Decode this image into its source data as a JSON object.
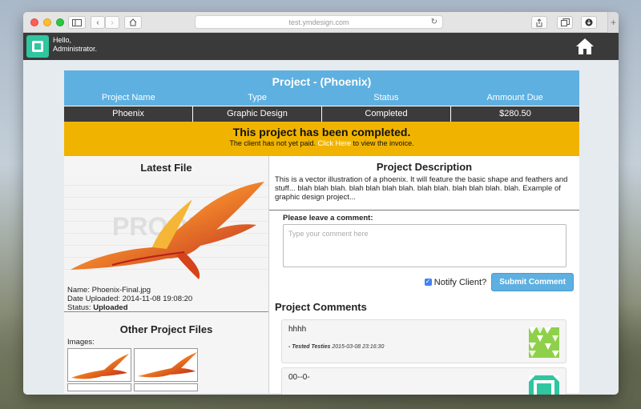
{
  "browser": {
    "address": "test.ymdesign.com"
  },
  "app": {
    "greeting_line1": "Hello,",
    "greeting_line2": "Administrator."
  },
  "project": {
    "title": "Project - (Phoenix)",
    "columns": [
      "Project Name",
      "Type",
      "Status",
      "Ammount Due"
    ],
    "values": [
      "Phoenix",
      "Graphic Design",
      "Completed",
      "$280.50"
    ]
  },
  "banner": {
    "title": "This project has been completed.",
    "sub_before": "The client has not yet paid.",
    "link": "Click Here",
    "sub_after": "to view the invoice."
  },
  "latest_file": {
    "heading": "Latest File",
    "watermark": "PROOF",
    "name_label": "Name:",
    "name": "Phoenix-Final.jpg",
    "date_label": "Date Uploaded:",
    "date": "2014-11-08 19:08:20",
    "status_label": "Status:",
    "status": "Uploaded"
  },
  "other_files": {
    "heading": "Other Project Files",
    "images_label": "Images:"
  },
  "description": {
    "heading": "Project Description",
    "text": "This is a vector illustration of a phoenix. It will feature the basic shape and feathers and stuff... blah blah blah. blah blah blah blah. blah blah. blah blah blah. blah. Example of graphic design project..."
  },
  "comment_form": {
    "label": "Please leave a comment:",
    "placeholder": "Type your comment here",
    "notify_label": "Notify Client?",
    "notify_checked": true,
    "submit_label": "Submit Comment"
  },
  "comments": {
    "heading": "Project Comments",
    "items": [
      {
        "text": "hhhh",
        "author": "- Tested Testies",
        "date": "2015-03-08 23:16:30"
      },
      {
        "text": "00--0-",
        "author": "",
        "date": ""
      }
    ]
  },
  "colors": {
    "header_blue": "#5eb0e0",
    "banner_yellow": "#f0b400",
    "dark_bar": "#3b3b3b",
    "accent_teal": "#2fc6a0"
  }
}
